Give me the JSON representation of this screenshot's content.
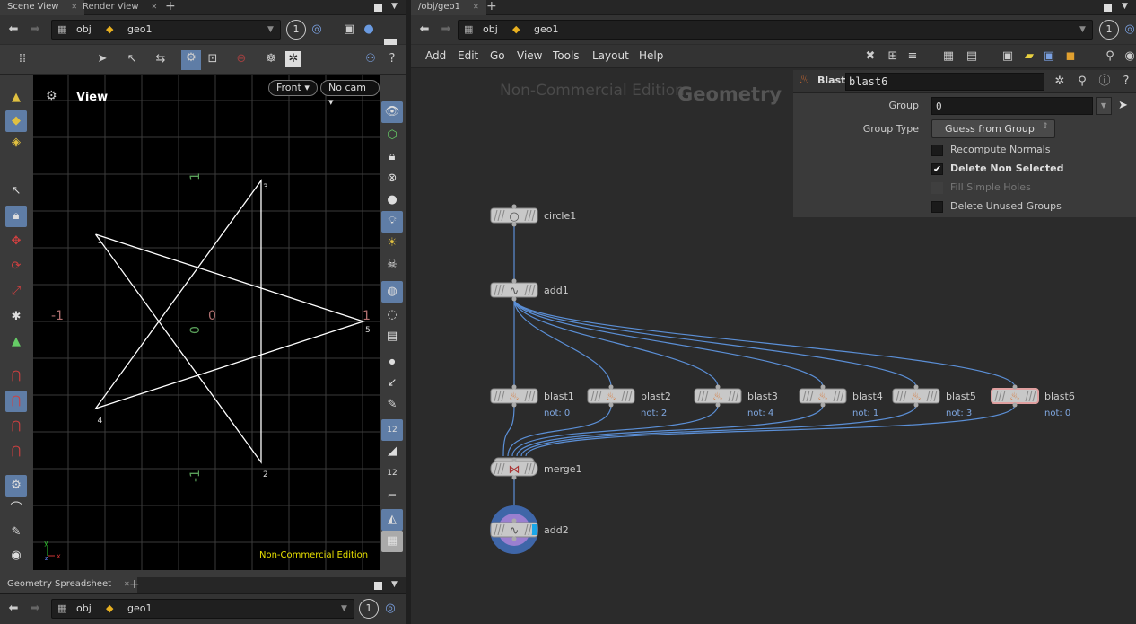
{
  "left_pane": {
    "tabs": [
      {
        "label": "Scene View",
        "active": true
      },
      {
        "label": "Render View",
        "active": false
      }
    ],
    "path": {
      "root": "obj",
      "node": "geo1"
    },
    "viewport_number": "1",
    "viewport": {
      "title": "View",
      "view_menu": "Front",
      "camera_menu": "No cam",
      "watermark": "Non-Commercial Edition",
      "axis_labels": {
        "x_neg": "-1",
        "x_zero": "0",
        "x_pos": "1",
        "y_pos": "1",
        "y_zero": "0",
        "y_neg": "-1"
      },
      "points": [
        {
          "num": "1",
          "x": -0.809,
          "y": 0.588
        },
        {
          "num": "2",
          "x": 0.309,
          "y": -0.951
        },
        {
          "num": "3",
          "x": 0.309,
          "y": 0.951
        },
        {
          "num": "4",
          "x": -0.809,
          "y": -0.588
        },
        {
          "num": "5",
          "x": 1.0,
          "y": 0.0
        }
      ],
      "polyline_order": [
        "1",
        "5",
        "4",
        "3",
        "2",
        "1"
      ],
      "axis_gizmo": {
        "y": "y",
        "x": "x",
        "z": "z"
      }
    },
    "bottom_tabs": [
      {
        "label": "Geometry Spreadsheet",
        "active": true
      }
    ],
    "bottom_path": {
      "root": "obj",
      "node": "geo1"
    },
    "bottom_number": "1"
  },
  "right_pane": {
    "tabs": [
      {
        "label": "/obj/geo1",
        "active": true
      }
    ],
    "path": {
      "root": "obj",
      "node": "geo1"
    },
    "number": "1",
    "menu": [
      "Add",
      "Edit",
      "Go",
      "View",
      "Tools",
      "Layout",
      "Help"
    ],
    "watermark": "Non-Commercial Edition",
    "context_label": "Geometry",
    "params": {
      "node_type": "Blast",
      "node_name": "blast6",
      "group_label": "Group",
      "group_value": "0",
      "group_type_label": "Group Type",
      "group_type_value": "Guess from Group",
      "checkboxes": [
        {
          "label": "Recompute Normals",
          "checked": false,
          "enabled": true
        },
        {
          "label": "Delete Non Selected",
          "checked": true,
          "enabled": true
        },
        {
          "label": "Fill Simple Holes",
          "checked": false,
          "enabled": false
        },
        {
          "label": "Delete Unused Groups",
          "checked": false,
          "enabled": true
        }
      ]
    },
    "nodes": [
      {
        "name": "circle1",
        "type": "circle",
        "info": ""
      },
      {
        "name": "add1",
        "type": "add",
        "info": ""
      },
      {
        "name": "blast1",
        "type": "blast",
        "info": "not: 0"
      },
      {
        "name": "blast2",
        "type": "blast",
        "info": "not: 2"
      },
      {
        "name": "blast3",
        "type": "blast",
        "info": "not: 4"
      },
      {
        "name": "blast4",
        "type": "blast",
        "info": "not: 1"
      },
      {
        "name": "blast5",
        "type": "blast",
        "info": "not: 3"
      },
      {
        "name": "blast6",
        "type": "blast",
        "info": "not: 0",
        "selected": true
      },
      {
        "name": "merge1",
        "type": "merge",
        "info": ""
      },
      {
        "name": "add2",
        "type": "add",
        "info": "",
        "display": true
      }
    ],
    "connections": [
      [
        "circle1",
        "add1"
      ],
      [
        "add1",
        "blast1"
      ],
      [
        "add1",
        "blast2"
      ],
      [
        "add1",
        "blast3"
      ],
      [
        "add1",
        "blast4"
      ],
      [
        "add1",
        "blast5"
      ],
      [
        "add1",
        "blast6"
      ],
      [
        "blast1",
        "merge1"
      ],
      [
        "blast2",
        "merge1"
      ],
      [
        "blast3",
        "merge1"
      ],
      [
        "blast4",
        "merge1"
      ],
      [
        "blast5",
        "merge1"
      ],
      [
        "blast6",
        "merge1"
      ],
      [
        "merge1",
        "add2"
      ]
    ]
  },
  "colors": {
    "wire": "#5b8fd6",
    "node_info": "#7fa7e0",
    "selected_outline": "#e0a0a0",
    "display_ring": "#3f66a8",
    "display_inner": "#9a7fd0",
    "display_flag": "#1aa7e8",
    "watermark_viewport": "#e8e000",
    "grid": "#3a3a3a",
    "axis_x_label": "#b07070",
    "axis_y_label": "#5aa05a"
  }
}
